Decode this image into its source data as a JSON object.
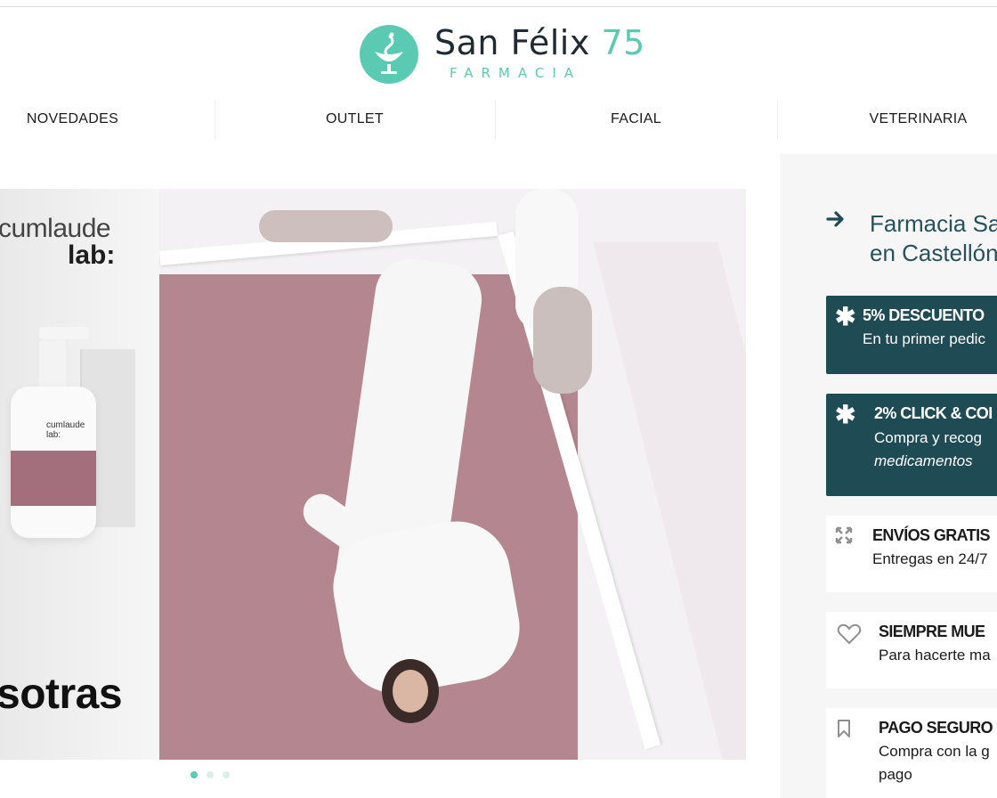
{
  "logo": {
    "name": "San Félix",
    "number": "75",
    "subtitle": "FARMACIA"
  },
  "nav": {
    "items": [
      "NOVEDADES",
      "OUTLET",
      "FACIAL",
      "VETERINARIA"
    ]
  },
  "hero": {
    "brand_line1": "cumlaude",
    "brand_line2": "lab:",
    "bottle_brand": "cumlaude lab:",
    "big_text": "sotras",
    "slides": 3,
    "active_slide": 1
  },
  "side": {
    "title_line1": "Farmacia Sa",
    "title_line2": "en Castellón",
    "cards": [
      {
        "title": "5% DESCUENTO",
        "desc": "En tu primer pedic",
        "icon": "asterisk-icon"
      },
      {
        "title": "2% CLICK & COI",
        "desc": "Compra y recog",
        "desc2": "medicamentos",
        "icon": "asterisk-icon"
      },
      {
        "title": "ENVÍOS GRATIS",
        "desc": "Entregas en 24/7",
        "icon": "expand-arrows-icon"
      },
      {
        "title": "SIEMPRE MUE",
        "desc": "Para hacerte ma",
        "icon": "heart-icon"
      },
      {
        "title": "PAGO SEGURO",
        "desc": "Compra con la g",
        "desc2": "pago",
        "icon": "bookmark-icon"
      }
    ]
  },
  "colors": {
    "brand": "#5bcab2",
    "dark_card": "#1f4b54",
    "title": "#27515c"
  }
}
